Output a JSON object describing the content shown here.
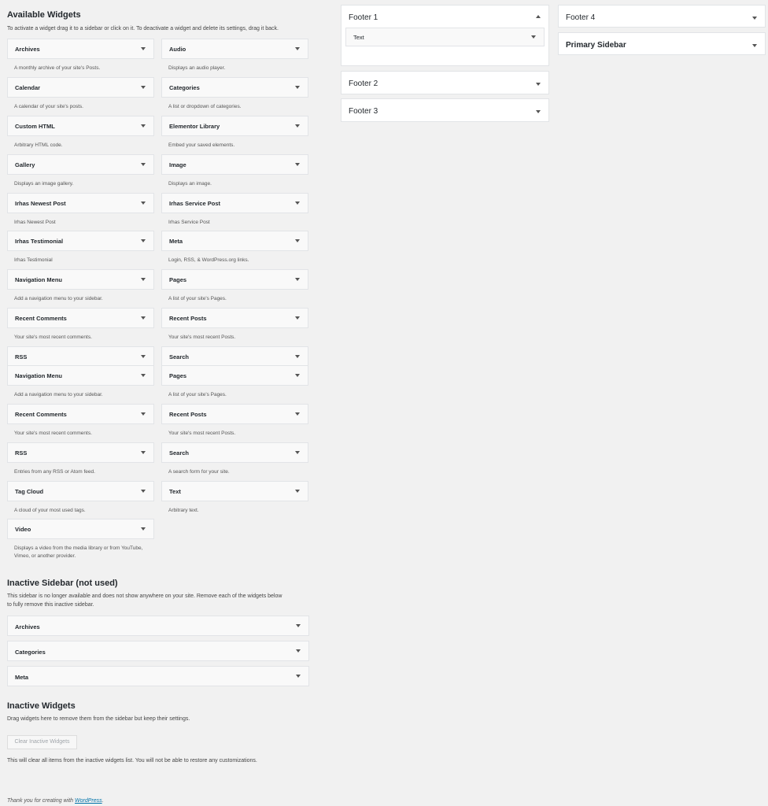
{
  "available": {
    "title": "Available Widgets",
    "description": "To activate a widget drag it to a sidebar or click on it. To deactivate a widget and delete its settings, drag it back.",
    "widgets": [
      {
        "title": "Archives",
        "desc": "A monthly archive of your site's Posts."
      },
      {
        "title": "Audio",
        "desc": "Displays an audio player."
      },
      {
        "title": "Calendar",
        "desc": "A calendar of your site's posts."
      },
      {
        "title": "Categories",
        "desc": "A list or dropdown of categories."
      },
      {
        "title": "Custom HTML",
        "desc": "Arbitrary HTML code."
      },
      {
        "title": "Elementor Library",
        "desc": "Embed your saved elements."
      },
      {
        "title": "Gallery",
        "desc": "Displays an image gallery."
      },
      {
        "title": "Image",
        "desc": "Displays an image."
      },
      {
        "title": "Irhas Newest Post",
        "desc": "Irhas Newest Post"
      },
      {
        "title": "Irhas Service Post",
        "desc": "Irhas Service Post"
      },
      {
        "title": "Irhas Testimonial",
        "desc": "Irhas Testimonial"
      },
      {
        "title": "Meta",
        "desc": "Login, RSS, & WordPress.org links."
      },
      {
        "title": "Navigation Menu",
        "desc": "Add a navigation menu to your sidebar."
      },
      {
        "title": "Pages",
        "desc": "A list of your site's Pages."
      },
      {
        "title": "Recent Comments",
        "desc": "Your site's most recent comments."
      },
      {
        "title": "Recent Posts",
        "desc": "Your site's most recent Posts."
      },
      {
        "title": "RSS",
        "desc": ""
      },
      {
        "title": "Search",
        "desc": ""
      },
      {
        "title": "Navigation Menu",
        "desc": "Add a navigation menu to your sidebar."
      },
      {
        "title": "Pages",
        "desc": "A list of your site's Pages."
      },
      {
        "title": "Recent Comments",
        "desc": "Your site's most recent comments."
      },
      {
        "title": "Recent Posts",
        "desc": "Your site's most recent Posts."
      },
      {
        "title": "RSS",
        "desc": "Entries from any RSS or Atom feed."
      },
      {
        "title": "Search",
        "desc": "A search form for your site."
      },
      {
        "title": "Tag Cloud",
        "desc": "A cloud of your most used tags."
      },
      {
        "title": "Text",
        "desc": "Arbitrary text."
      },
      {
        "title": "Video",
        "desc": "Displays a video from the media library or from YouTube, Vimeo, or another provider."
      }
    ]
  },
  "inactive_sidebar": {
    "title": "Inactive Sidebar (not used)",
    "description_line1": "This sidebar is no longer available and does not show anywhere on your site. Remove each of the widgets below",
    "description_line2": "to fully remove this inactive sidebar.",
    "widgets": [
      "Archives",
      "Categories",
      "Meta"
    ]
  },
  "inactive_widgets": {
    "title": "Inactive Widgets",
    "description": "Drag widgets here to remove them from the sidebar but keep their settings.",
    "clear_button": "Clear Inactive Widgets",
    "note": "This will clear all items from the inactive widgets list. You will not be able to restore any customizations."
  },
  "sidebars": {
    "footer1": {
      "title": "Footer 1",
      "widget": "Text"
    },
    "footer2": {
      "title": "Footer 2"
    },
    "footer3": {
      "title": "Footer 3"
    },
    "footer4": {
      "title": "Footer 4"
    },
    "primary": {
      "title": "Primary Sidebar"
    }
  },
  "footer": {
    "prefix": "Thank you for creating with ",
    "link": "WordPress",
    "suffix": "."
  }
}
